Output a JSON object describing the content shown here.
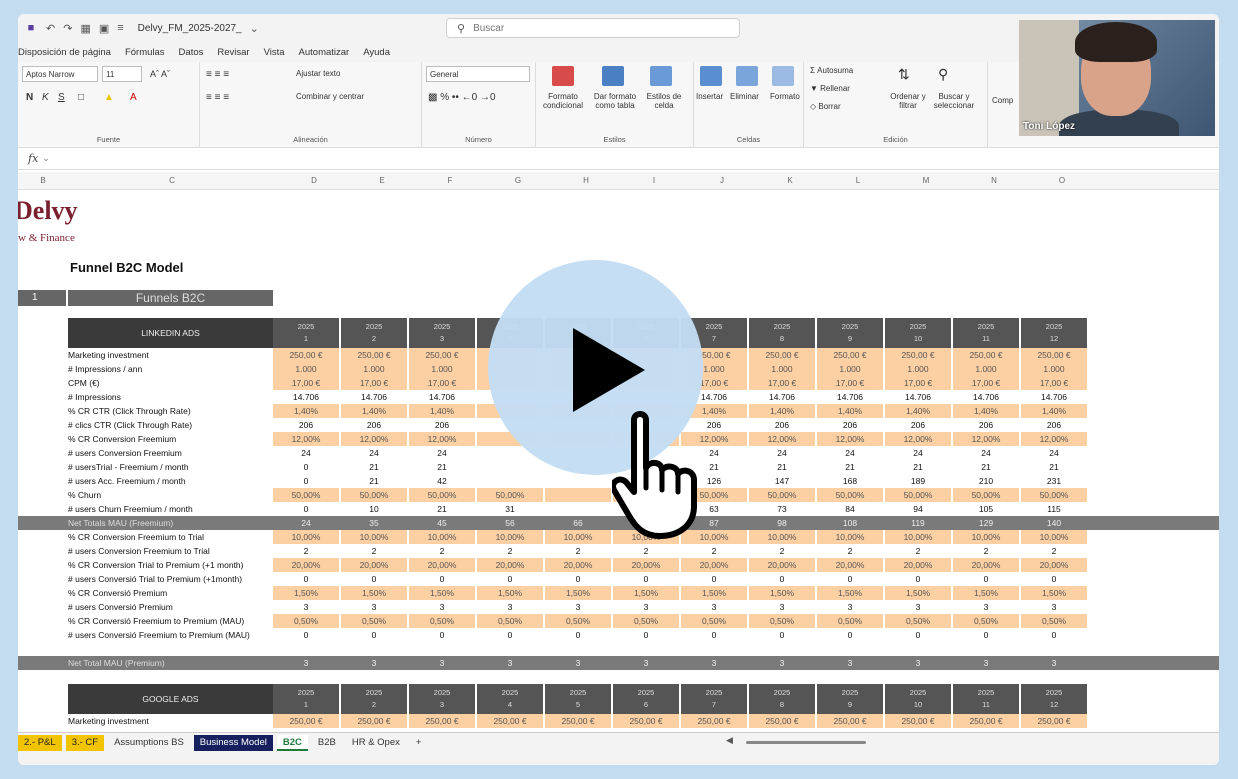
{
  "titlebar": {
    "filename": "Delvy_FM_2025-2027_",
    "search_placeholder": "Buscar"
  },
  "menu": [
    "Disposición de página",
    "Fórmulas",
    "Datos",
    "Revisar",
    "Vista",
    "Automatizar",
    "Ayuda"
  ],
  "ribbon": {
    "font_name": "Aptos Narrow",
    "font_size": "11",
    "fuente_label": "Fuente",
    "ajustar_texto": "Ajustar texto",
    "combinar": "Combinar y centrar",
    "alineacion_label": "Alineación",
    "number_format": "General",
    "numero_label": "Número",
    "formato_cond": "Formato condicional",
    "dar_formato": "Dar formato como tabla",
    "estilos_celda": "Estilos de celda",
    "estilos_label": "Estilos",
    "insertar": "Insertar",
    "eliminar": "Eliminar",
    "formato": "Formato",
    "celdas_label": "Celdas",
    "autosuma": "Autosuma",
    "rellenar": "Rellenar",
    "borrar": "Borrar",
    "ordenar": "Ordenar y filtrar",
    "buscar": "Buscar y seleccionar",
    "edicion_label": "Edición",
    "comp": "Comp"
  },
  "formula_bar": {
    "fx": "fx"
  },
  "columns": [
    "B",
    "C",
    "D",
    "E",
    "F",
    "G",
    "H",
    "I",
    "J",
    "K",
    "L",
    "M",
    "N",
    "O"
  ],
  "brand": {
    "logo": "Delvy",
    "sub": "w & Finance"
  },
  "sheet_title": "Funnel B2C Model",
  "section": {
    "num": "1",
    "title": "Funnels B2C"
  },
  "linkedin": {
    "label": "LINKEDIN ADS",
    "year": "2025",
    "months": [
      "1",
      "2",
      "3",
      "4",
      "5",
      "6",
      "7",
      "8",
      "9",
      "10",
      "11",
      "12"
    ],
    "rows": [
      {
        "label": "Marketing investment",
        "style": "ora",
        "values": [
          "250,00 €",
          "250,00 €",
          "250,00 €",
          "",
          "",
          "",
          "250,00 €",
          "250,00 €",
          "250,00 €",
          "250,00 €",
          "250,00 €",
          "250,00 €"
        ]
      },
      {
        "label": "# Impressions / ann",
        "style": "ora",
        "values": [
          "1.000",
          "1.000",
          "1.000",
          "",
          "",
          "",
          "1.000",
          "1.000",
          "1.000",
          "1.000",
          "1.000",
          "1.000"
        ]
      },
      {
        "label": "CPM (€)",
        "style": "ora",
        "values": [
          "17,00 €",
          "17,00 €",
          "17,00 €",
          "",
          "",
          "",
          "17,00 €",
          "17,00 €",
          "17,00 €",
          "17,00 €",
          "17,00 €",
          "17,00 €"
        ]
      },
      {
        "label": "# Impressions",
        "style": "plain",
        "values": [
          "14.706",
          "14.706",
          "14.706",
          "",
          "",
          "",
          "14.706",
          "14.706",
          "14.706",
          "14.706",
          "14.706",
          "14.706"
        ]
      },
      {
        "label": "% CR CTR (Click Through Rate)",
        "style": "ora",
        "values": [
          "1,40%",
          "1,40%",
          "1,40%",
          "",
          "",
          "",
          "1,40%",
          "1,40%",
          "1,40%",
          "1,40%",
          "1,40%",
          "1,40%"
        ]
      },
      {
        "label": "# clics CTR (Click Through Rate)",
        "style": "plain",
        "values": [
          "206",
          "206",
          "206",
          "",
          "",
          "",
          "206",
          "206",
          "206",
          "206",
          "206",
          "206"
        ]
      },
      {
        "label": "% CR Conversion Freemium",
        "style": "ora",
        "values": [
          "12,00%",
          "12,00%",
          "12,00%",
          "",
          "",
          "",
          "12,00%",
          "12,00%",
          "12,00%",
          "12,00%",
          "12,00%",
          "12,00%"
        ]
      },
      {
        "label": "# users Conversion Freemium",
        "style": "plain",
        "values": [
          "24",
          "24",
          "24",
          "",
          "",
          "4",
          "24",
          "24",
          "24",
          "24",
          "24",
          "24"
        ]
      },
      {
        "label": "# usersTrial - Freemium / month",
        "style": "plain",
        "values": [
          "0",
          "21",
          "21",
          "",
          "",
          "",
          "21",
          "21",
          "21",
          "21",
          "21",
          "21"
        ]
      },
      {
        "label": "# users Acc. Freemium / month",
        "style": "plain",
        "values": [
          "0",
          "21",
          "42",
          "",
          "",
          "",
          "126",
          "147",
          "168",
          "189",
          "210",
          "231"
        ]
      },
      {
        "label": "% Churn",
        "style": "ora",
        "values": [
          "50,00%",
          "50,00%",
          "50,00%",
          "50,00%",
          "",
          "",
          "50,00%",
          "50,00%",
          "50,00%",
          "50,00%",
          "50,00%",
          "50,00%"
        ]
      },
      {
        "label": "# users Churn Freemium / month",
        "style": "plain",
        "values": [
          "0",
          "10",
          "21",
          "31",
          "",
          "",
          "63",
          "73",
          "84",
          "94",
          "105",
          "115"
        ]
      },
      {
        "label": "Net Totals MAU (Freemium)",
        "style": "dark",
        "values": [
          "24",
          "35",
          "45",
          "56",
          "66",
          "",
          "87",
          "98",
          "108",
          "119",
          "129",
          "140"
        ]
      },
      {
        "label": "% CR Conversion Freemium to Trial",
        "style": "ora",
        "values": [
          "10,00%",
          "10,00%",
          "10,00%",
          "10,00%",
          "10,00%",
          "10,00%",
          "10,00%",
          "10,00%",
          "10,00%",
          "10,00%",
          "10,00%",
          "10,00%"
        ]
      },
      {
        "label": "# users Conversion Freemium to Trial",
        "style": "plain",
        "values": [
          "2",
          "2",
          "2",
          "2",
          "2",
          "2",
          "2",
          "2",
          "2",
          "2",
          "2",
          "2"
        ]
      },
      {
        "label": "% CR Conversion Trial to Premium (+1 month)",
        "style": "ora",
        "values": [
          "20,00%",
          "20,00%",
          "20,00%",
          "20,00%",
          "20,00%",
          "20,00%",
          "20,00%",
          "20,00%",
          "20,00%",
          "20,00%",
          "20,00%",
          "20,00%"
        ]
      },
      {
        "label": "# users Conversió Trial to Premium (+1month)",
        "style": "plain",
        "values": [
          "0",
          "0",
          "0",
          "0",
          "0",
          "0",
          "0",
          "0",
          "0",
          "0",
          "0",
          "0"
        ]
      },
      {
        "label": "% CR Conversió Premium",
        "style": "ora",
        "values": [
          "1,50%",
          "1,50%",
          "1,50%",
          "1,50%",
          "1,50%",
          "1,50%",
          "1,50%",
          "1,50%",
          "1,50%",
          "1,50%",
          "1,50%",
          "1,50%"
        ]
      },
      {
        "label": "# users Conversió Premium",
        "style": "plain",
        "values": [
          "3",
          "3",
          "3",
          "3",
          "3",
          "3",
          "3",
          "3",
          "3",
          "3",
          "3",
          "3"
        ]
      },
      {
        "label": "% CR Conversió Freemium to Premium (MAU)",
        "style": "ora",
        "values": [
          "0,50%",
          "0,50%",
          "0,50%",
          "0,50%",
          "0,50%",
          "0,50%",
          "0,50%",
          "0,50%",
          "0,50%",
          "0,50%",
          "0,50%",
          "0,50%"
        ]
      },
      {
        "label": "# users Conversió Freemium to Premium (MAU)",
        "style": "plain",
        "values": [
          "0",
          "0",
          "0",
          "0",
          "0",
          "0",
          "0",
          "0",
          "0",
          "0",
          "0",
          "0"
        ]
      }
    ],
    "net_premium": {
      "label": "Net Total MAU (Premium)",
      "values": [
        "3",
        "3",
        "3",
        "3",
        "3",
        "3",
        "3",
        "3",
        "3",
        "3",
        "3",
        "3"
      ]
    }
  },
  "google": {
    "label": "GOOGLE ADS",
    "year": "2025",
    "months": [
      "1",
      "2",
      "3",
      "4",
      "5",
      "6",
      "7",
      "8",
      "9",
      "10",
      "11",
      "12"
    ],
    "rows": [
      {
        "label": "Marketing investment",
        "style": "ora",
        "values": [
          "250,00 €",
          "250,00 €",
          "250,00 €",
          "250,00 €",
          "250,00 €",
          "250,00 €",
          "250,00 €",
          "250,00 €",
          "250,00 €",
          "250,00 €",
          "250,00 €",
          "250,00 €"
        ]
      }
    ]
  },
  "tabs": [
    {
      "label": "2.- P&L",
      "style": "yel"
    },
    {
      "label": "3.- CF",
      "style": "yel"
    },
    {
      "label": "Assumptions BS",
      "style": "plain"
    },
    {
      "label": "Business Model",
      "style": "navy"
    },
    {
      "label": "B2C",
      "style": "act"
    },
    {
      "label": "B2B",
      "style": "plain"
    },
    {
      "label": "HR & Opex",
      "style": "plain"
    },
    {
      "label": "+",
      "style": "plain"
    }
  ],
  "webcam": {
    "name": "Toni López"
  }
}
